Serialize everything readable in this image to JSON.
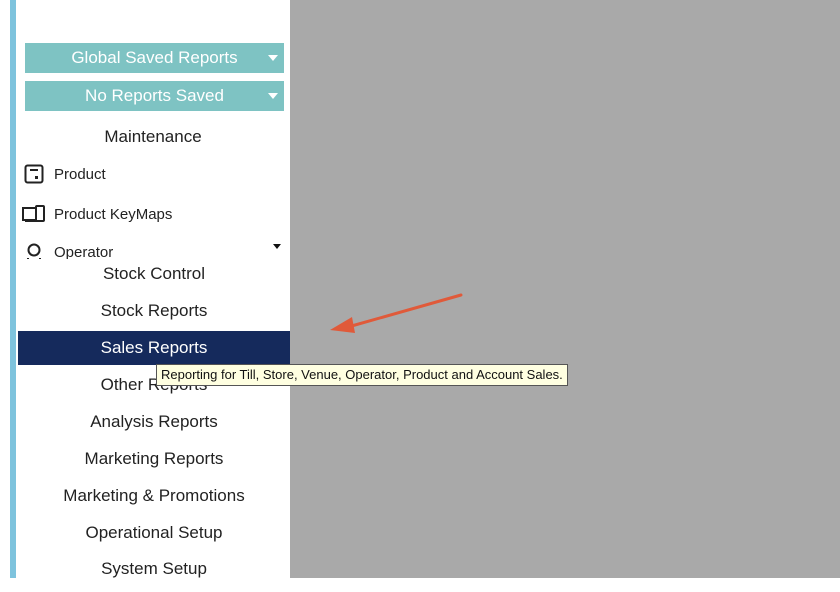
{
  "dropdowns": [
    {
      "label": "Global Saved Reports"
    },
    {
      "label": "No Reports Saved"
    }
  ],
  "maintenance": {
    "title": "Maintenance",
    "items": [
      {
        "label": "Product",
        "icon": "product-icon"
      },
      {
        "label": "Product KeyMaps",
        "icon": "keymap-icon"
      },
      {
        "label": "Operator",
        "icon": "operator-icon"
      }
    ]
  },
  "nav": {
    "items": [
      {
        "label": "Stock Control"
      },
      {
        "label": "Stock Reports"
      },
      {
        "label": "Sales Reports",
        "selected": true
      },
      {
        "label": "Other Reports"
      },
      {
        "label": "Analysis Reports"
      },
      {
        "label": "Marketing Reports"
      },
      {
        "label": "Marketing & Promotions"
      },
      {
        "label": "Operational Setup"
      },
      {
        "label": "System Setup"
      }
    ]
  },
  "tooltip": {
    "text": "Reporting for Till, Store, Venue, Operator, Product and Account Sales."
  },
  "colors": {
    "accent": "#7ec3dd",
    "dropdown": "#7ec3c3",
    "selected": "#152a5c",
    "content_bg": "#a9a9a9",
    "arrow": "#e05a3a"
  }
}
